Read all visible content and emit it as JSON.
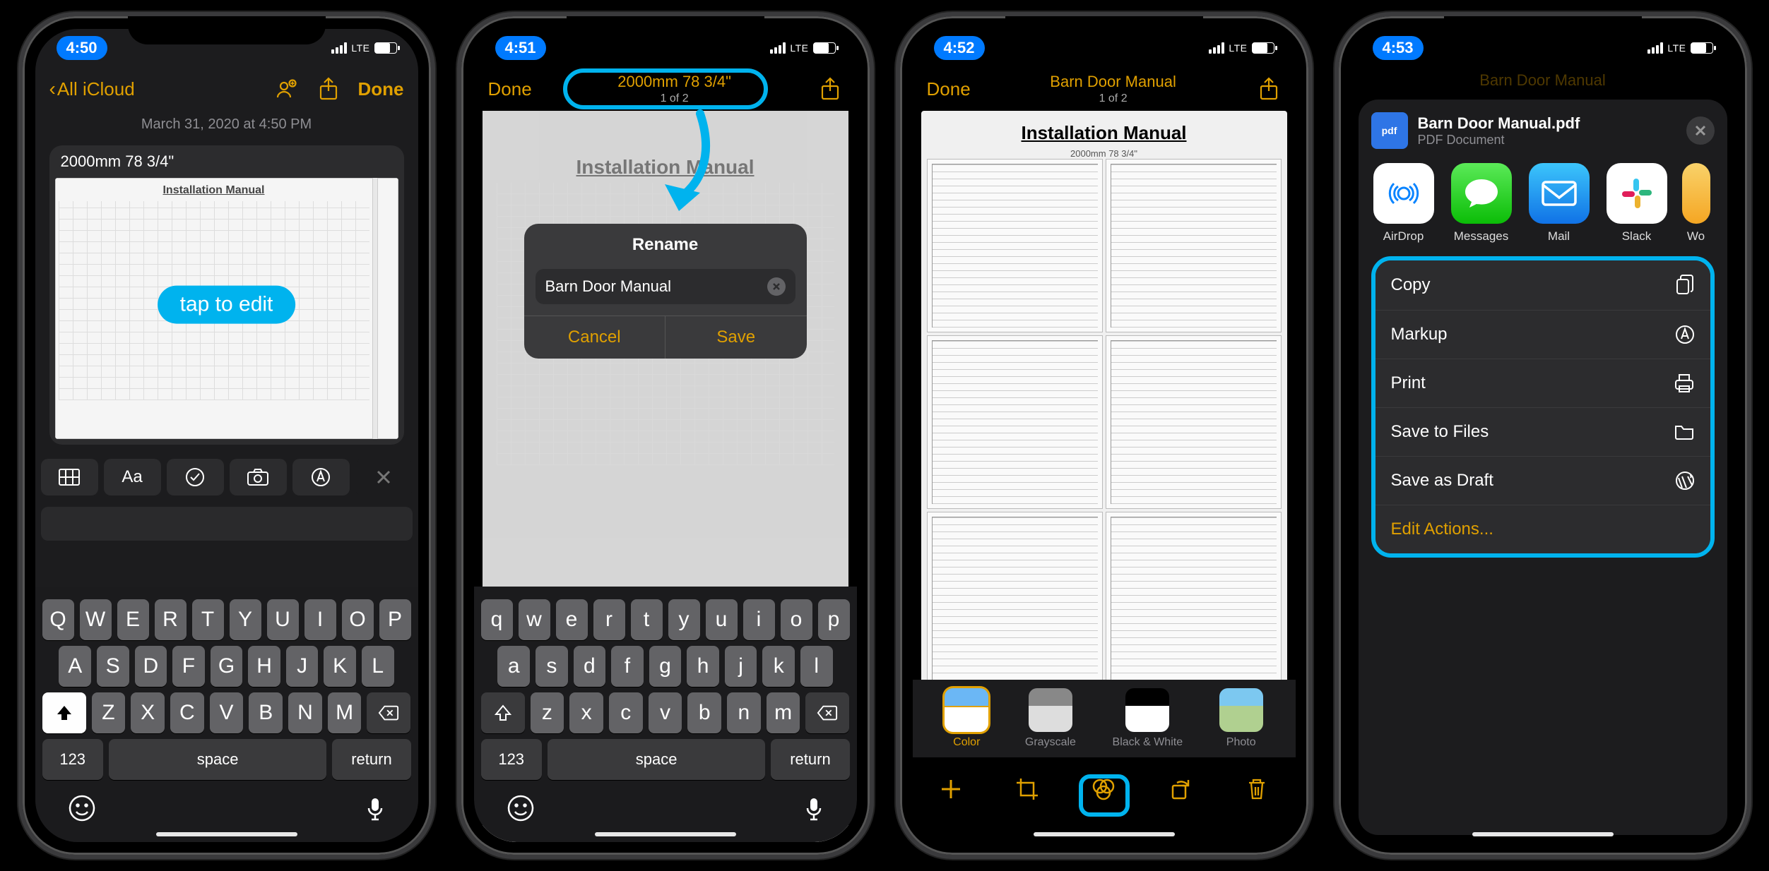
{
  "phones": {
    "p1": {
      "time": "4:50",
      "carrier": "LTE",
      "nav_back": "All iCloud",
      "nav_done": "Done",
      "date": "March 31, 2020 at 4:50 PM",
      "attachment_title": "2000mm 78 3/4\"",
      "tap_hint": "tap to edit",
      "doc_title": "Installation Manual",
      "keyboard": {
        "row1": [
          "Q",
          "W",
          "E",
          "R",
          "T",
          "Y",
          "U",
          "I",
          "O",
          "P"
        ],
        "row2": [
          "A",
          "S",
          "D",
          "F",
          "G",
          "H",
          "J",
          "K",
          "L"
        ],
        "row3": [
          "Z",
          "X",
          "C",
          "V",
          "B",
          "N",
          "M"
        ],
        "k123": "123",
        "space": "space",
        "return": "return"
      }
    },
    "p2": {
      "time": "4:51",
      "carrier": "LTE",
      "nav_done": "Done",
      "title": "2000mm 78 3/4\"",
      "subtitle": "1 of 2",
      "dialog_title": "Rename",
      "dialog_value": "Barn Door Manual",
      "cancel": "Cancel",
      "save": "Save",
      "doc_title": "Installation Manual",
      "keyboard": {
        "row1": [
          "q",
          "w",
          "e",
          "r",
          "t",
          "y",
          "u",
          "i",
          "o",
          "p"
        ],
        "row2": [
          "a",
          "s",
          "d",
          "f",
          "g",
          "h",
          "j",
          "k",
          "l"
        ],
        "row3": [
          "z",
          "x",
          "c",
          "v",
          "b",
          "n",
          "m"
        ],
        "k123": "123",
        "space": "space",
        "return": "return"
      }
    },
    "p3": {
      "time": "4:52",
      "carrier": "LTE",
      "nav_done": "Done",
      "title": "Barn Door Manual",
      "subtitle": "1 of 2",
      "doc_title": "Installation Manual",
      "doc_subtitle": "2000mm 78 3/4\"",
      "filters": {
        "color": "Color",
        "grayscale": "Grayscale",
        "bw": "Black & White",
        "photo": "Photo"
      }
    },
    "p4": {
      "time": "4:53",
      "carrier": "LTE",
      "bg_title": "Barn Door Manual",
      "sheet_title": "Barn Door Manual.pdf",
      "sheet_sub": "PDF Document",
      "pdf_badge": "pdf",
      "apps": {
        "airdrop": "AirDrop",
        "messages": "Messages",
        "mail": "Mail",
        "slack": "Slack",
        "extra": "Wo"
      },
      "actions": {
        "copy": "Copy",
        "markup": "Markup",
        "print": "Print",
        "save_files": "Save to Files",
        "save_draft": "Save as Draft",
        "edit": "Edit Actions..."
      }
    }
  }
}
